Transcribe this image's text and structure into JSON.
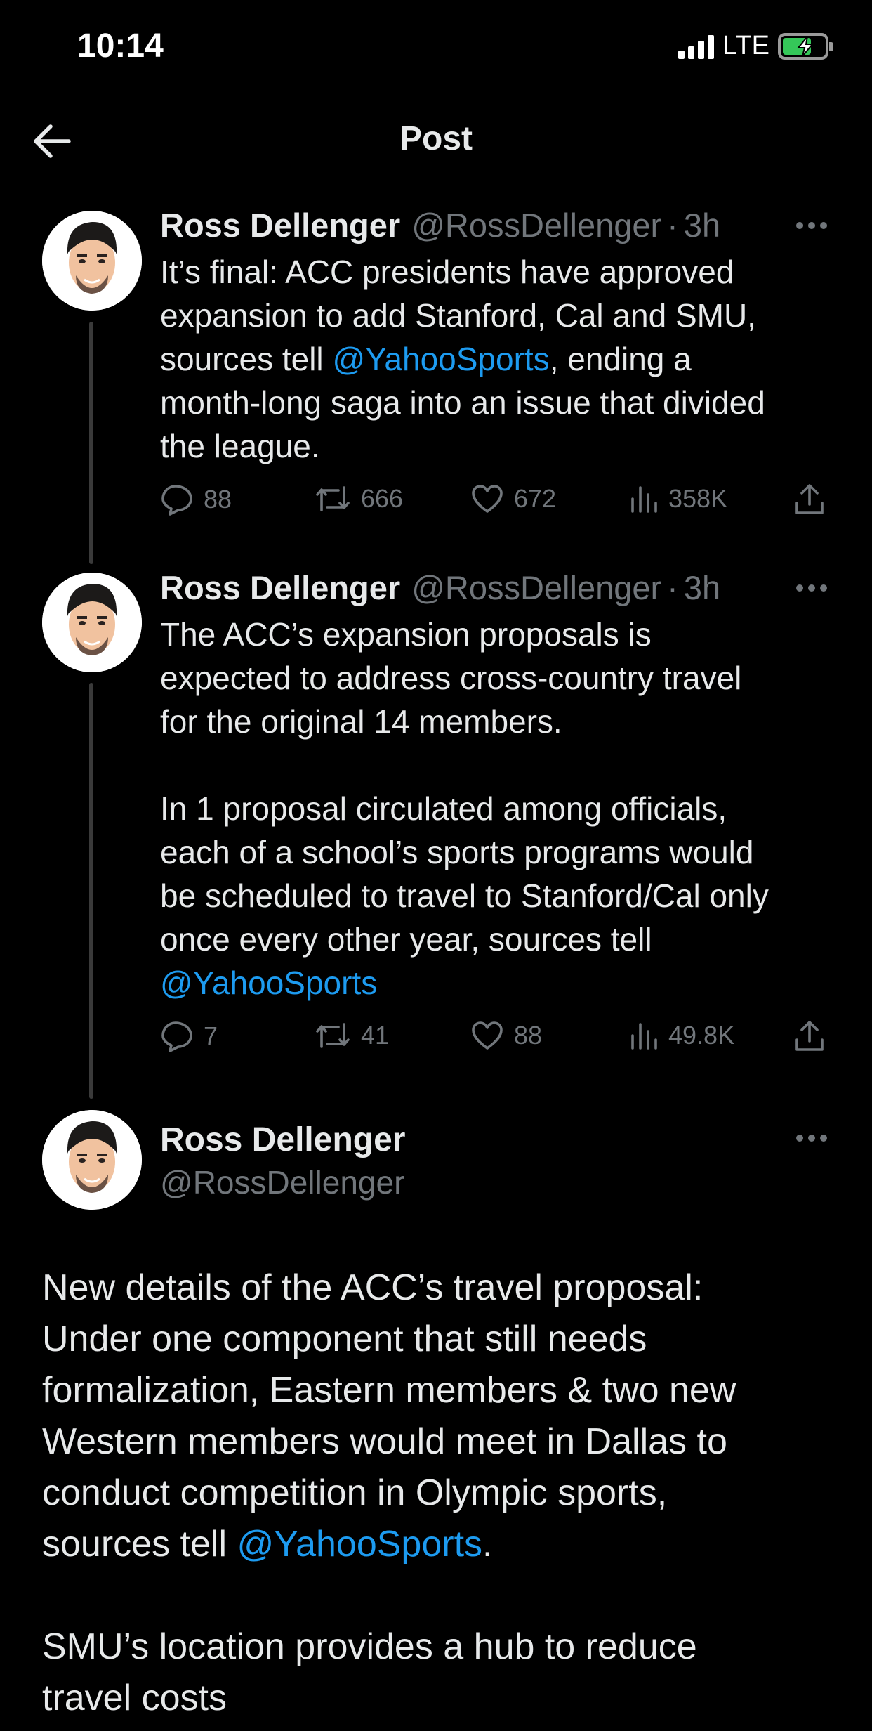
{
  "status_bar": {
    "time": "10:14",
    "network": "LTE",
    "battery_color": "#35c759"
  },
  "header": {
    "title": "Post",
    "back_icon": "arrow-left-icon"
  },
  "colors": {
    "background": "#000000",
    "text": "#e7e9ea",
    "muted": "#71767b",
    "link": "#1d9bf0"
  },
  "posts": [
    {
      "name": "Ross Dellenger",
      "handle": "@RossDellenger",
      "separator": "·",
      "time": "3h",
      "text_before": "It’s final: ACC presidents have approved\nexpansion to add Stanford, Cal and SMU,\nsources tell ",
      "mention": "@YahooSports",
      "text_after": ", ending a\nmonth-long saga into an issue that divided\nthe league.",
      "replies": "88",
      "reposts": "666",
      "likes": "672",
      "views": "358K"
    },
    {
      "name": "Ross Dellenger",
      "handle": "@RossDellenger",
      "separator": "·",
      "time": "3h",
      "text_before": "The ACC’s expansion proposals is\nexpected to address cross-country travel\nfor the original 14 members.\n\nIn 1 proposal circulated among officials,\neach of a school’s sports programs would\nbe scheduled to travel to Stanford/Cal only\nonce every other year, sources tell\n",
      "mention": "@YahooSports",
      "text_after": "",
      "replies": "7",
      "reposts": "41",
      "likes": "88",
      "views": "49.8K"
    }
  ],
  "main_post": {
    "name": "Ross Dellenger",
    "handle": "@RossDellenger",
    "text_before": "New details of the ACC’s travel proposal:\nUnder one component that still needs\nformalization, Eastern members & two new\nWestern members would meet in Dallas to\nconduct competition in Olympic sports,\nsources tell ",
    "mention": "@YahooSports",
    "text_after": ".\n\nSMU’s location provides a hub to reduce\ntravel costs"
  }
}
